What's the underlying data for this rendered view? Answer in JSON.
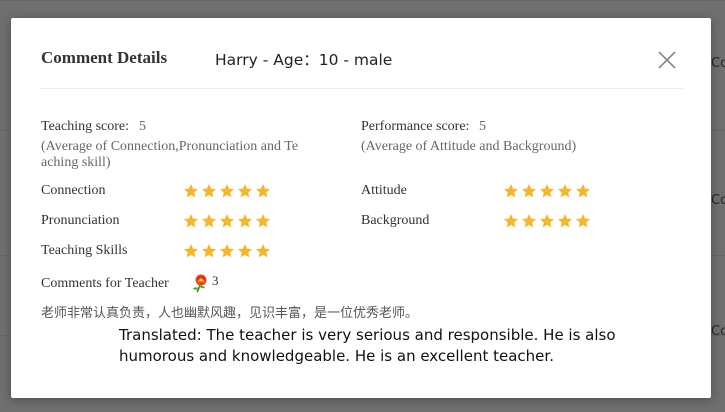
{
  "background": {
    "row_labels": [
      "Co",
      "Co",
      "Co"
    ]
  },
  "modal": {
    "title": "Comment Details",
    "student_info": "Harry - Age：10 - male",
    "close_icon": "close-icon",
    "teaching_score": {
      "label": "Teaching score:",
      "value": "5",
      "note": "(Average of Connection,Pronunciation and Teaching skill)",
      "note_line1": "(Average of Connection,Pronunciation and Te",
      "note_line2": "aching skill)"
    },
    "performance_score": {
      "label": "Performance score:",
      "value": "5",
      "note": "(Average of Attitude and Background)"
    },
    "ratings_left": [
      {
        "label": "Connection",
        "stars": 5,
        "max": 5
      },
      {
        "label": "Pronunciation",
        "stars": 5,
        "max": 5
      },
      {
        "label": "Teaching Skills",
        "stars": 5,
        "max": 5
      }
    ],
    "ratings_right": [
      {
        "label": "Attitude",
        "stars": 5,
        "max": 5
      },
      {
        "label": "Background",
        "stars": 5,
        "max": 5
      }
    ],
    "comments": {
      "label": "Comments for Teacher",
      "flower_icon": "flower-icon",
      "flower_count": "3",
      "text": "老师非常认真负责，人也幽默风趣，见识丰富，是一位优秀老师。"
    },
    "translation": "Translated: The teacher is very serious and responsible. He is also humorous and knowledgeable. He is an excellent teacher."
  },
  "colors": {
    "star": "#f5b72a",
    "overlay": "rgba(0,0,0,0.55)"
  }
}
